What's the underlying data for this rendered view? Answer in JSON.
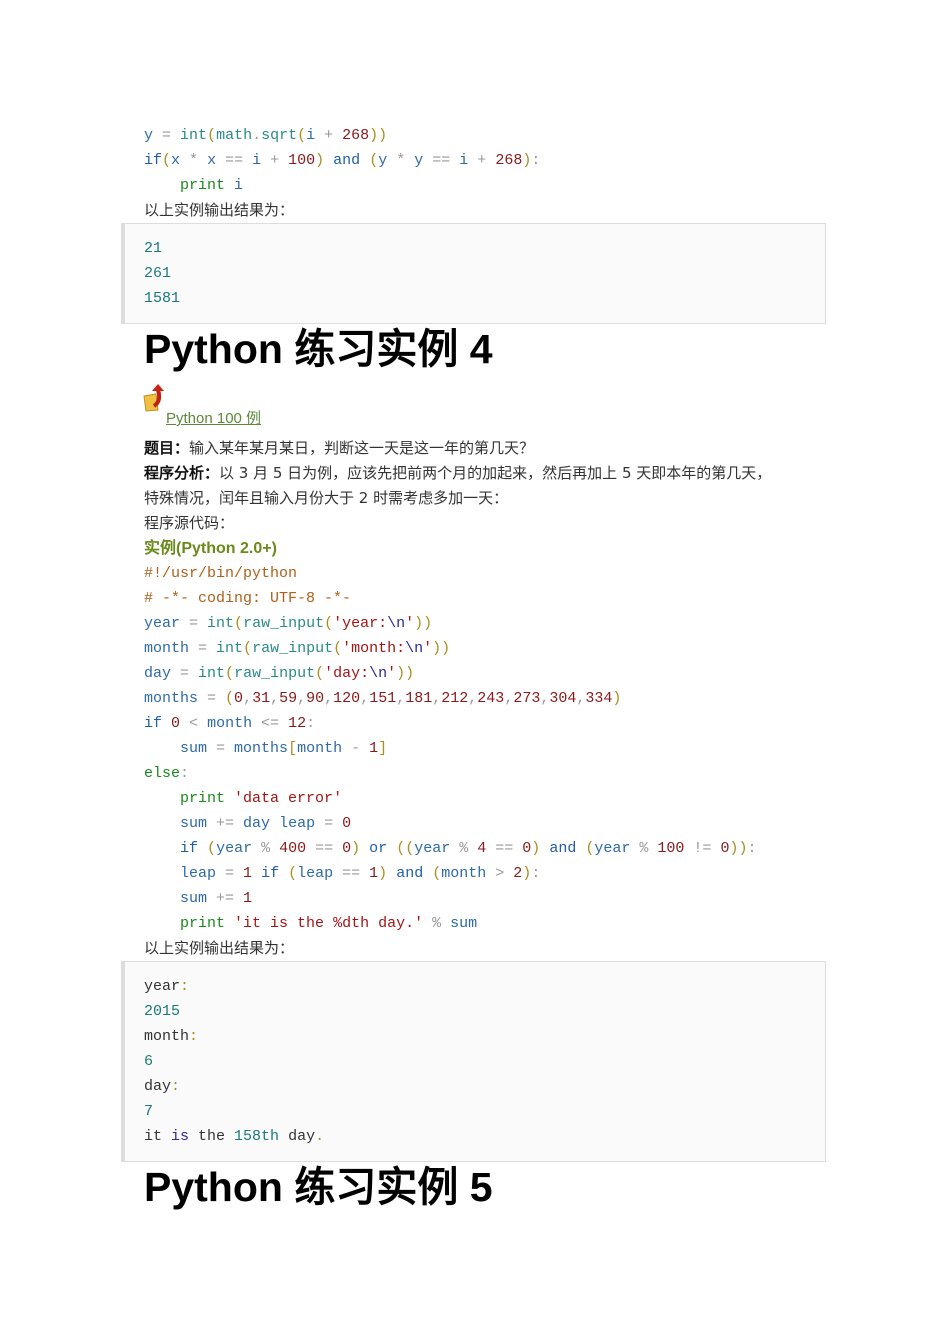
{
  "code_top": [
    [
      [
        "v",
        "y"
      ],
      [
        "o",
        " = "
      ],
      [
        "f",
        "int"
      ],
      [
        "p",
        "("
      ],
      [
        "f",
        "math"
      ],
      [
        "o",
        "."
      ],
      [
        "f",
        "sqrt"
      ],
      [
        "p",
        "("
      ],
      [
        "v",
        "i"
      ],
      [
        "o",
        " + "
      ],
      [
        "n",
        "268"
      ],
      [
        "p",
        "))"
      ]
    ],
    [
      [
        "k",
        "if"
      ],
      [
        "p",
        "("
      ],
      [
        "v",
        "x"
      ],
      [
        "o",
        " * "
      ],
      [
        "v",
        "x"
      ],
      [
        "o",
        " == "
      ],
      [
        "v",
        "i"
      ],
      [
        "o",
        " + "
      ],
      [
        "n",
        "100"
      ],
      [
        "p",
        ")"
      ],
      [
        "t",
        " "
      ],
      [
        "k",
        "and"
      ],
      [
        "t",
        " "
      ],
      [
        "p",
        "("
      ],
      [
        "v",
        "y"
      ],
      [
        "o",
        " * "
      ],
      [
        "v",
        "y"
      ],
      [
        "o",
        " == "
      ],
      [
        "v",
        "i"
      ],
      [
        "o",
        " + "
      ],
      [
        "n",
        "268"
      ],
      [
        "p",
        ")"
      ],
      [
        "o",
        ":"
      ]
    ],
    [
      [
        "t",
        "    "
      ],
      [
        "pr",
        "print"
      ],
      [
        "t",
        " "
      ],
      [
        "v",
        "i"
      ]
    ]
  ],
  "output_label_1": "以上实例输出结果为：",
  "output_1": [
    [
      [
        "on",
        "21"
      ]
    ],
    [
      [
        "on",
        "261"
      ]
    ],
    [
      [
        "on",
        "1581"
      ]
    ]
  ],
  "heading_4": "Python 练习实例 4",
  "link": {
    "label": "Python 100 例",
    "icon": "folder-up-arrow-icon"
  },
  "problem_label": "题目：",
  "problem_text": "输入某年某月某日，判断这一天是这一年的第几天？",
  "analysis_label": "程序分析：",
  "analysis_text_1": "以 3 月 5 日为例，应该先把前两个月的加起来，然后再加上 5 天即本年的第几天，",
  "analysis_text_2": "特殊情况，闰年且输入月份大于 2 时需考虑多加一天：",
  "source_label": "程序源代码：",
  "example_heading": "实例(Python 2.0+)",
  "code_main": [
    [
      [
        "c",
        "#!/usr/bin/python"
      ]
    ],
    [
      [
        "c",
        "# -*- coding: UTF-8 -*-"
      ]
    ],
    [
      [
        "v",
        "year"
      ],
      [
        "o",
        " = "
      ],
      [
        "f",
        "int"
      ],
      [
        "p",
        "("
      ],
      [
        "f",
        "raw_input"
      ],
      [
        "p",
        "("
      ],
      [
        "s",
        "'year:"
      ],
      [
        "ok",
        "\\n"
      ],
      [
        "s",
        "'"
      ],
      [
        "p",
        "))"
      ]
    ],
    [
      [
        "v",
        "month"
      ],
      [
        "o",
        " = "
      ],
      [
        "f",
        "int"
      ],
      [
        "p",
        "("
      ],
      [
        "f",
        "raw_input"
      ],
      [
        "p",
        "("
      ],
      [
        "s",
        "'month:"
      ],
      [
        "ok",
        "\\n"
      ],
      [
        "s",
        "'"
      ],
      [
        "p",
        "))"
      ]
    ],
    [
      [
        "v",
        "day"
      ],
      [
        "o",
        " = "
      ],
      [
        "f",
        "int"
      ],
      [
        "p",
        "("
      ],
      [
        "f",
        "raw_input"
      ],
      [
        "p",
        "("
      ],
      [
        "s",
        "'day:"
      ],
      [
        "ok",
        "\\n"
      ],
      [
        "s",
        "'"
      ],
      [
        "p",
        "))"
      ]
    ],
    [
      [
        "v",
        "months"
      ],
      [
        "o",
        " = "
      ],
      [
        "p",
        "("
      ],
      [
        "n",
        "0"
      ],
      [
        "o",
        ","
      ],
      [
        "n",
        "31"
      ],
      [
        "o",
        ","
      ],
      [
        "n",
        "59"
      ],
      [
        "o",
        ","
      ],
      [
        "n",
        "90"
      ],
      [
        "o",
        ","
      ],
      [
        "n",
        "120"
      ],
      [
        "o",
        ","
      ],
      [
        "n",
        "151"
      ],
      [
        "o",
        ","
      ],
      [
        "n",
        "181"
      ],
      [
        "o",
        ","
      ],
      [
        "n",
        "212"
      ],
      [
        "o",
        ","
      ],
      [
        "n",
        "243"
      ],
      [
        "o",
        ","
      ],
      [
        "n",
        "273"
      ],
      [
        "o",
        ","
      ],
      [
        "n",
        "304"
      ],
      [
        "o",
        ","
      ],
      [
        "n",
        "334"
      ],
      [
        "p",
        ")"
      ]
    ],
    [
      [
        "k",
        "if"
      ],
      [
        "t",
        " "
      ],
      [
        "n",
        "0"
      ],
      [
        "o",
        " < "
      ],
      [
        "v",
        "month"
      ],
      [
        "o",
        " <= "
      ],
      [
        "n",
        "12"
      ],
      [
        "o",
        ":"
      ]
    ],
    [
      [
        "t",
        "    "
      ],
      [
        "v",
        "sum"
      ],
      [
        "o",
        " = "
      ],
      [
        "v",
        "months"
      ],
      [
        "p",
        "["
      ],
      [
        "v",
        "month"
      ],
      [
        "o",
        " - "
      ],
      [
        "n",
        "1"
      ],
      [
        "p",
        "]"
      ]
    ],
    [
      [
        "pr",
        "else"
      ],
      [
        "o",
        ":"
      ]
    ],
    [
      [
        "t",
        "    "
      ],
      [
        "pr",
        "print"
      ],
      [
        "t",
        " "
      ],
      [
        "s",
        "'data error'"
      ]
    ],
    [
      [
        "t",
        "    "
      ],
      [
        "v",
        "sum"
      ],
      [
        "o",
        " += "
      ],
      [
        "v",
        "day"
      ],
      [
        "t",
        " "
      ],
      [
        "v",
        "leap"
      ],
      [
        "o",
        " = "
      ],
      [
        "n",
        "0"
      ]
    ],
    [
      [
        "t",
        "    "
      ],
      [
        "k",
        "if"
      ],
      [
        "t",
        " "
      ],
      [
        "p",
        "("
      ],
      [
        "v",
        "year"
      ],
      [
        "o",
        " % "
      ],
      [
        "n",
        "400"
      ],
      [
        "o",
        " == "
      ],
      [
        "n",
        "0"
      ],
      [
        "p",
        ")"
      ],
      [
        "t",
        " "
      ],
      [
        "k",
        "or"
      ],
      [
        "t",
        " "
      ],
      [
        "p",
        "(("
      ],
      [
        "v",
        "year"
      ],
      [
        "o",
        " % "
      ],
      [
        "n",
        "4"
      ],
      [
        "o",
        " == "
      ],
      [
        "n",
        "0"
      ],
      [
        "p",
        ")"
      ],
      [
        "t",
        " "
      ],
      [
        "k",
        "and"
      ],
      [
        "t",
        " "
      ],
      [
        "p",
        "("
      ],
      [
        "v",
        "year"
      ],
      [
        "o",
        " % "
      ],
      [
        "n",
        "100"
      ],
      [
        "o",
        " != "
      ],
      [
        "n",
        "0"
      ],
      [
        "p",
        "))"
      ],
      [
        "o",
        ":"
      ]
    ],
    [
      [
        "t",
        "    "
      ],
      [
        "v",
        "leap"
      ],
      [
        "o",
        " = "
      ],
      [
        "n",
        "1"
      ],
      [
        "t",
        " "
      ],
      [
        "k",
        "if"
      ],
      [
        "t",
        " "
      ],
      [
        "p",
        "("
      ],
      [
        "v",
        "leap"
      ],
      [
        "o",
        " == "
      ],
      [
        "n",
        "1"
      ],
      [
        "p",
        ")"
      ],
      [
        "t",
        " "
      ],
      [
        "k",
        "and"
      ],
      [
        "t",
        " "
      ],
      [
        "p",
        "("
      ],
      [
        "v",
        "month"
      ],
      [
        "o",
        " > "
      ],
      [
        "n",
        "2"
      ],
      [
        "p",
        ")"
      ],
      [
        "o",
        ":"
      ]
    ],
    [
      [
        "t",
        "    "
      ],
      [
        "v",
        "sum"
      ],
      [
        "o",
        " += "
      ],
      [
        "n",
        "1"
      ]
    ],
    [
      [
        "t",
        "    "
      ],
      [
        "pr",
        "print"
      ],
      [
        "t",
        " "
      ],
      [
        "s",
        "'it is the %dth day.'"
      ],
      [
        "o",
        " % "
      ],
      [
        "v",
        "sum"
      ]
    ]
  ],
  "output_label_2": "以上实例输出结果为：",
  "output_2": [
    [
      [
        "t",
        "year"
      ],
      [
        "p",
        ":"
      ]
    ],
    [
      [
        "on",
        "2015"
      ]
    ],
    [
      [
        "t",
        "month"
      ],
      [
        "p",
        ":"
      ]
    ],
    [
      [
        "on",
        "6"
      ]
    ],
    [
      [
        "t",
        "day"
      ],
      [
        "p",
        ":"
      ]
    ],
    [
      [
        "on",
        "7"
      ]
    ],
    [
      [
        "t",
        "it "
      ],
      [
        "ok",
        "is"
      ],
      [
        "t",
        " the "
      ],
      [
        "on",
        "158th"
      ],
      [
        "t",
        " day"
      ],
      [
        "p",
        "."
      ]
    ]
  ],
  "heading_5": "Python 练习实例 5"
}
